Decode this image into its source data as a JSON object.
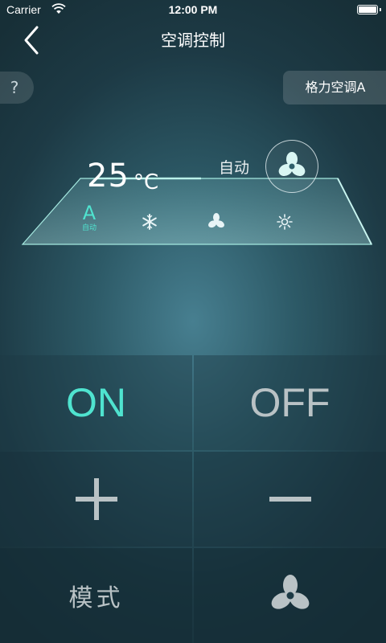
{
  "status_bar": {
    "carrier": "Carrier",
    "time": "12:00 PM"
  },
  "nav": {
    "title": "空调控制"
  },
  "help": {
    "label": "?"
  },
  "device": {
    "name": "格力空调A"
  },
  "display": {
    "temperature": "25",
    "unit": "°C",
    "mode_text": "自动",
    "modes": [
      {
        "glyph": "A",
        "label": "自动",
        "icon": "auto-mode-icon",
        "active": true
      },
      {
        "icon": "snowflake-icon",
        "active": false
      },
      {
        "icon": "fan-mode-icon",
        "active": false
      },
      {
        "icon": "sun-icon",
        "active": false
      }
    ]
  },
  "controls": {
    "on_label": "ON",
    "off_label": "OFF",
    "mode_label": "模式",
    "increase_icon": "plus-icon",
    "decrease_icon": "minus-icon",
    "fan_icon": "fan-icon"
  },
  "colors": {
    "accent": "#4fe3cf",
    "inactive_text": "#b9c2c5",
    "background_center": "#477f90",
    "background_edge": "#172f37"
  }
}
